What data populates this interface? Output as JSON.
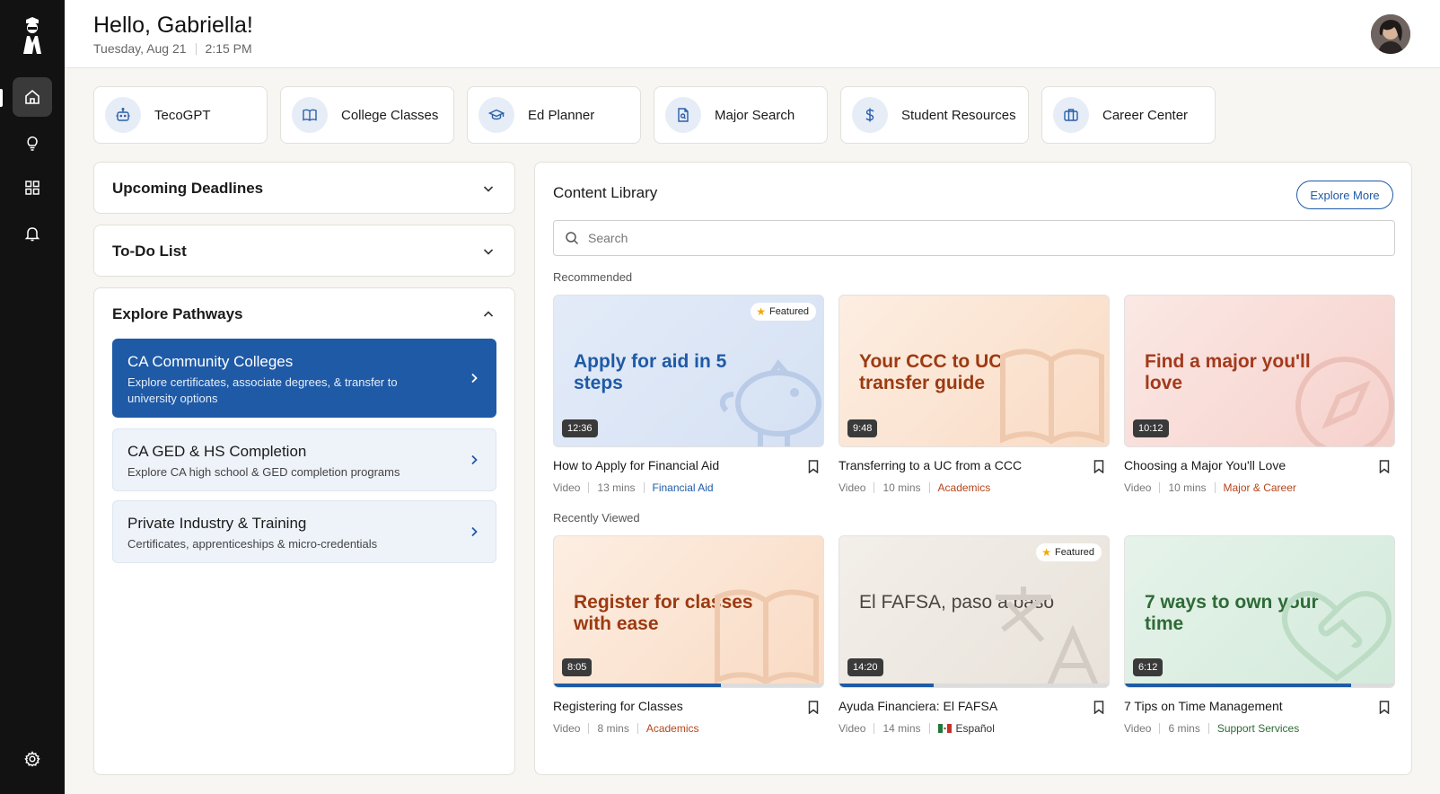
{
  "header": {
    "greeting": "Hello, Gabriella!",
    "date": "Tuesday, Aug 21",
    "time": "2:15 PM"
  },
  "sidebar": {
    "items": [
      {
        "icon": "home-icon",
        "active": true
      },
      {
        "icon": "lightbulb-icon"
      },
      {
        "icon": "grid-icon"
      },
      {
        "icon": "bell-icon"
      }
    ],
    "settings_icon": "gear-icon"
  },
  "quick_links": [
    {
      "label": "TecoGPT",
      "icon": "bot-icon"
    },
    {
      "label": "College Classes",
      "icon": "book-icon"
    },
    {
      "label": "Ed Planner",
      "icon": "graduation-cap-icon"
    },
    {
      "label": "Major Search",
      "icon": "document-search-icon"
    },
    {
      "label": "Student Resources",
      "icon": "dollar-icon"
    },
    {
      "label": "Career Center",
      "icon": "briefcase-icon"
    }
  ],
  "panels": {
    "deadlines": "Upcoming Deadlines",
    "todo": "To-Do List",
    "pathways": "Explore Pathways"
  },
  "pathways": [
    {
      "title": "CA Community Colleges",
      "desc": "Explore certificates, associate degrees, & transfer to university options"
    },
    {
      "title": "CA GED & HS Completion",
      "desc": "Explore CA high school & GED completion programs"
    },
    {
      "title": "Private Industry & Training",
      "desc": "Certificates, apprenticeships & micro-credentials"
    }
  ],
  "library": {
    "title": "Content Library",
    "explore_label": "Explore More",
    "search_placeholder": "Search",
    "recommended_label": "Recommended",
    "recent_label": "Recently Viewed",
    "featured_label": "Featured",
    "recommended": [
      {
        "thumb": "Apply for aid in 5 steps",
        "duration": "12:36",
        "title": "How to Apply for Financial Aid",
        "type": "Video",
        "length": "13 mins",
        "tag": "Financial Aid",
        "tag_color": "#1f5aa6",
        "featured": true
      },
      {
        "thumb": "Your CCC to UC transfer guide",
        "duration": "9:48",
        "title": "Transferring to a UC from a CCC",
        "type": "Video",
        "length": "10 mins",
        "tag": "Academics",
        "tag_color": "#b5451b"
      },
      {
        "thumb": "Find a major you'll love",
        "duration": "10:12",
        "title": "Choosing a Major You'll Love",
        "type": "Video",
        "length": "10 mins",
        "tag": "Major & Career",
        "tag_color": "#b5451b"
      }
    ],
    "recent": [
      {
        "thumb": "Register for classes with ease",
        "duration": "8:05",
        "title": "Registering for Classes",
        "type": "Video",
        "length": "8 mins",
        "tag": "Academics",
        "tag_color": "#b5451b",
        "progress": 0.62
      },
      {
        "thumb": "El FAFSA, paso a paso",
        "duration": "14:20",
        "title": "Ayuda Financiera: El FAFSA",
        "type": "Video",
        "length": "14 mins",
        "tag": "Español",
        "tag_color": "#333333",
        "featured": true,
        "progress": 0.35
      },
      {
        "thumb": "7 ways to own your time",
        "duration": "6:12",
        "title": "7 Tips on Time Management",
        "type": "Video",
        "length": "6 mins",
        "tag": "Support Services",
        "tag_color": "#2e6b36",
        "progress": 0.84
      }
    ]
  }
}
